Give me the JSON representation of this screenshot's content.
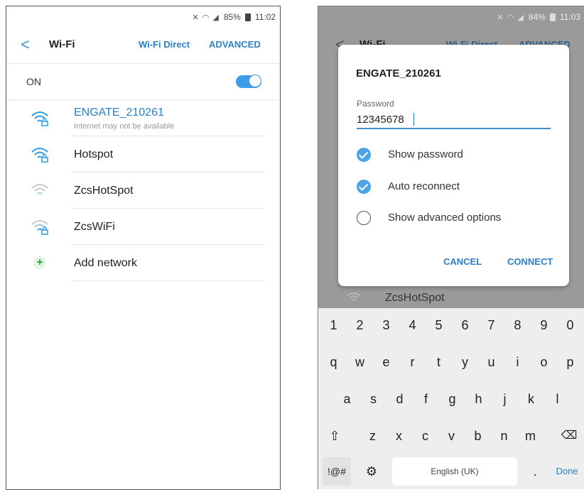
{
  "phone1": {
    "status": {
      "battery": "85%",
      "time": "11:02"
    },
    "appbar": {
      "title": "Wi-Fi",
      "wifi_direct": "Wi-Fi Direct",
      "advanced": "ADVANCED"
    },
    "toggle_row": {
      "label": "ON",
      "state": "on"
    },
    "networks": [
      {
        "name": "ENGATE_210261",
        "subtitle": "Internet may not be available",
        "connected": true,
        "secured": true,
        "signal": "strong"
      },
      {
        "name": "Hotspot",
        "secured": true,
        "signal": "strong"
      },
      {
        "name": "ZcsHotSpot",
        "secured": false,
        "signal": "weak"
      },
      {
        "name": "ZcsWiFi",
        "secured": true,
        "signal": "weak"
      },
      {
        "name": "Add network",
        "icon": "plus-icon"
      }
    ]
  },
  "phone2": {
    "status": {
      "battery": "84%",
      "time": "11:03"
    },
    "appbar": {
      "title": "Wi-Fi",
      "wifi_direct": "Wi-Fi Direct",
      "advanced": "ADVANCED"
    },
    "dialog": {
      "title": "ENGATE_210261",
      "password_label": "Password",
      "password_value": "12345678",
      "options": [
        {
          "label": "Show password",
          "checked": true
        },
        {
          "label": "Auto reconnect",
          "checked": true
        },
        {
          "label": "Show advanced options",
          "checked": false
        }
      ],
      "cancel": "CANCEL",
      "connect": "CONNECT"
    },
    "peek_network": "ZcsHotSpot",
    "keyboard": {
      "numbers": [
        "1",
        "2",
        "3",
        "4",
        "5",
        "6",
        "7",
        "8",
        "9",
        "0"
      ],
      "row1": [
        "q",
        "w",
        "e",
        "r",
        "t",
        "y",
        "u",
        "i",
        "o",
        "p"
      ],
      "row2": [
        "a",
        "s",
        "d",
        "f",
        "g",
        "h",
        "j",
        "k",
        "l"
      ],
      "row3": [
        "z",
        "x",
        "c",
        "v",
        "b",
        "n",
        "m"
      ],
      "shift": "⇧",
      "backspace": "⌫",
      "symbols": "!@#",
      "settings": "⚙",
      "space": "English (UK)",
      "period": ".",
      "done": "Done"
    }
  },
  "colors": {
    "accent": "#2d7fc7",
    "toggle": "#3d9ce8",
    "add_green": "#3aa046"
  }
}
